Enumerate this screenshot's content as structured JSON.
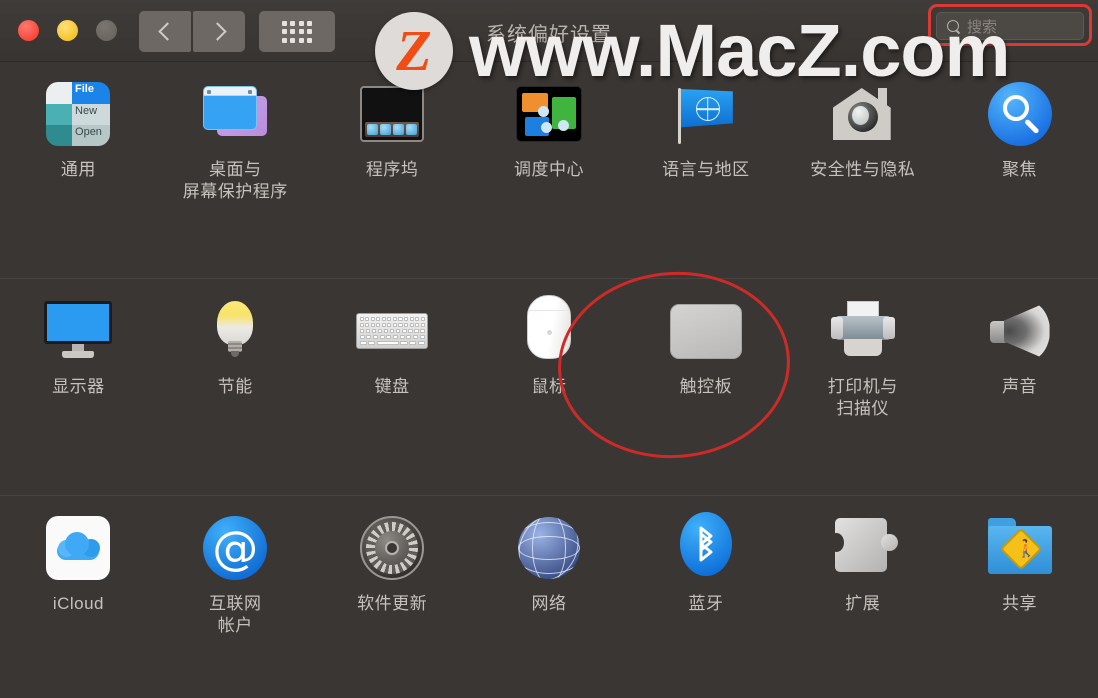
{
  "window": {
    "title": "系统偏好设置",
    "traffic_lights": [
      "close",
      "minimize",
      "zoom"
    ],
    "nav": {
      "back_label": "‹",
      "forward_label": "›"
    },
    "grid_button_name": "show-all",
    "search": {
      "placeholder": "搜索",
      "value": "",
      "highlighted": true
    }
  },
  "colors": {
    "background": "#3a3633",
    "toolbar": "#3f3b38",
    "label_text": "#c6c1bc",
    "annotation_red": "#cc2b28",
    "search_highlight": "#d93a37",
    "accent_blue": "#1268e0"
  },
  "sections": [
    {
      "name": "personal",
      "items": [
        {
          "label": "通用",
          "icon": "general-icon"
        },
        {
          "label": "桌面与\n屏幕保护程序",
          "icon": "desktop-screensaver-icon"
        },
        {
          "label": "程序坞",
          "icon": "dock-icon"
        },
        {
          "label": "调度中心",
          "icon": "mission-control-icon"
        },
        {
          "label": "语言与地区",
          "icon": "language-region-icon"
        },
        {
          "label": "安全性与隐私",
          "icon": "security-privacy-icon"
        },
        {
          "label": "聚焦",
          "icon": "spotlight-icon"
        }
      ]
    },
    {
      "name": "hardware",
      "items": [
        {
          "label": "显示器",
          "icon": "displays-icon"
        },
        {
          "label": "节能",
          "icon": "energy-saver-icon"
        },
        {
          "label": "键盘",
          "icon": "keyboard-icon"
        },
        {
          "label": "鼠标",
          "icon": "mouse-icon"
        },
        {
          "label": "触控板",
          "icon": "trackpad-icon",
          "highlighted": true
        },
        {
          "label": "打印机与\n扫描仪",
          "icon": "printers-scanners-icon"
        },
        {
          "label": "声音",
          "icon": "sound-icon"
        }
      ]
    },
    {
      "name": "internet-wireless",
      "items": [
        {
          "label": "iCloud",
          "icon": "icloud-icon"
        },
        {
          "label": "互联网\n帐户",
          "icon": "internet-accounts-icon"
        },
        {
          "label": "软件更新",
          "icon": "software-update-icon"
        },
        {
          "label": "网络",
          "icon": "network-icon"
        },
        {
          "label": "蓝牙",
          "icon": "bluetooth-icon"
        },
        {
          "label": "扩展",
          "icon": "extensions-icon"
        },
        {
          "label": "共享",
          "icon": "sharing-icon"
        }
      ]
    }
  ],
  "watermark": {
    "logo_letter": "Z",
    "text": "www.MacZ.com"
  }
}
